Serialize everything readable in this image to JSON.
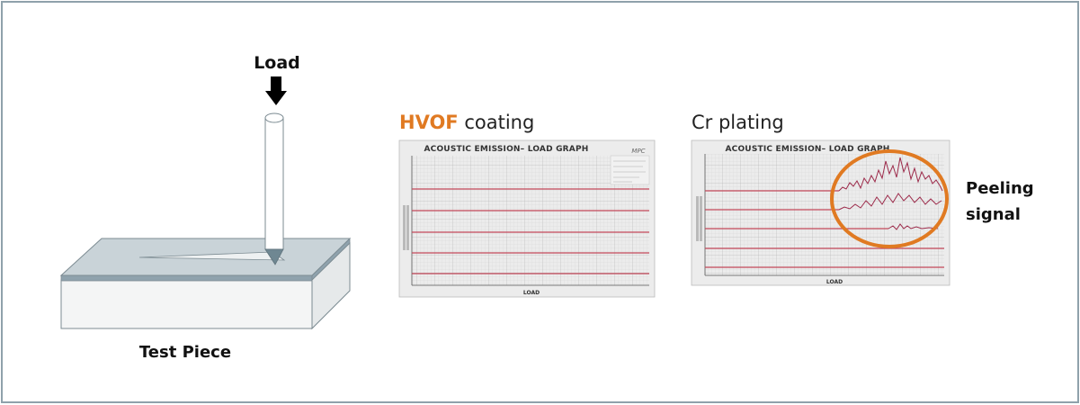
{
  "figure": {
    "load_label": "Load",
    "test_piece_label": "Test Piece",
    "panels": [
      {
        "title_highlight": "HVOF",
        "title_rest": " coating",
        "graph_title": "ACOUSTIC EMISSION– LOAD GRAPH",
        "x_axis_label": "LOAD",
        "logo": "MPC"
      },
      {
        "title_highlight": "",
        "title_rest": "Cr plating",
        "graph_title": "ACOUSTIC EMISSION– LOAD GRAPH",
        "x_axis_label": "LOAD"
      }
    ],
    "annotation": {
      "line1": "Peeling",
      "line2": "signal"
    },
    "colors": {
      "highlight": "#e07a22",
      "ellipse": "#e07a22",
      "trace": "#c2475a",
      "grid": "#c9c9c9",
      "frame": "#8fa1ab"
    }
  }
}
